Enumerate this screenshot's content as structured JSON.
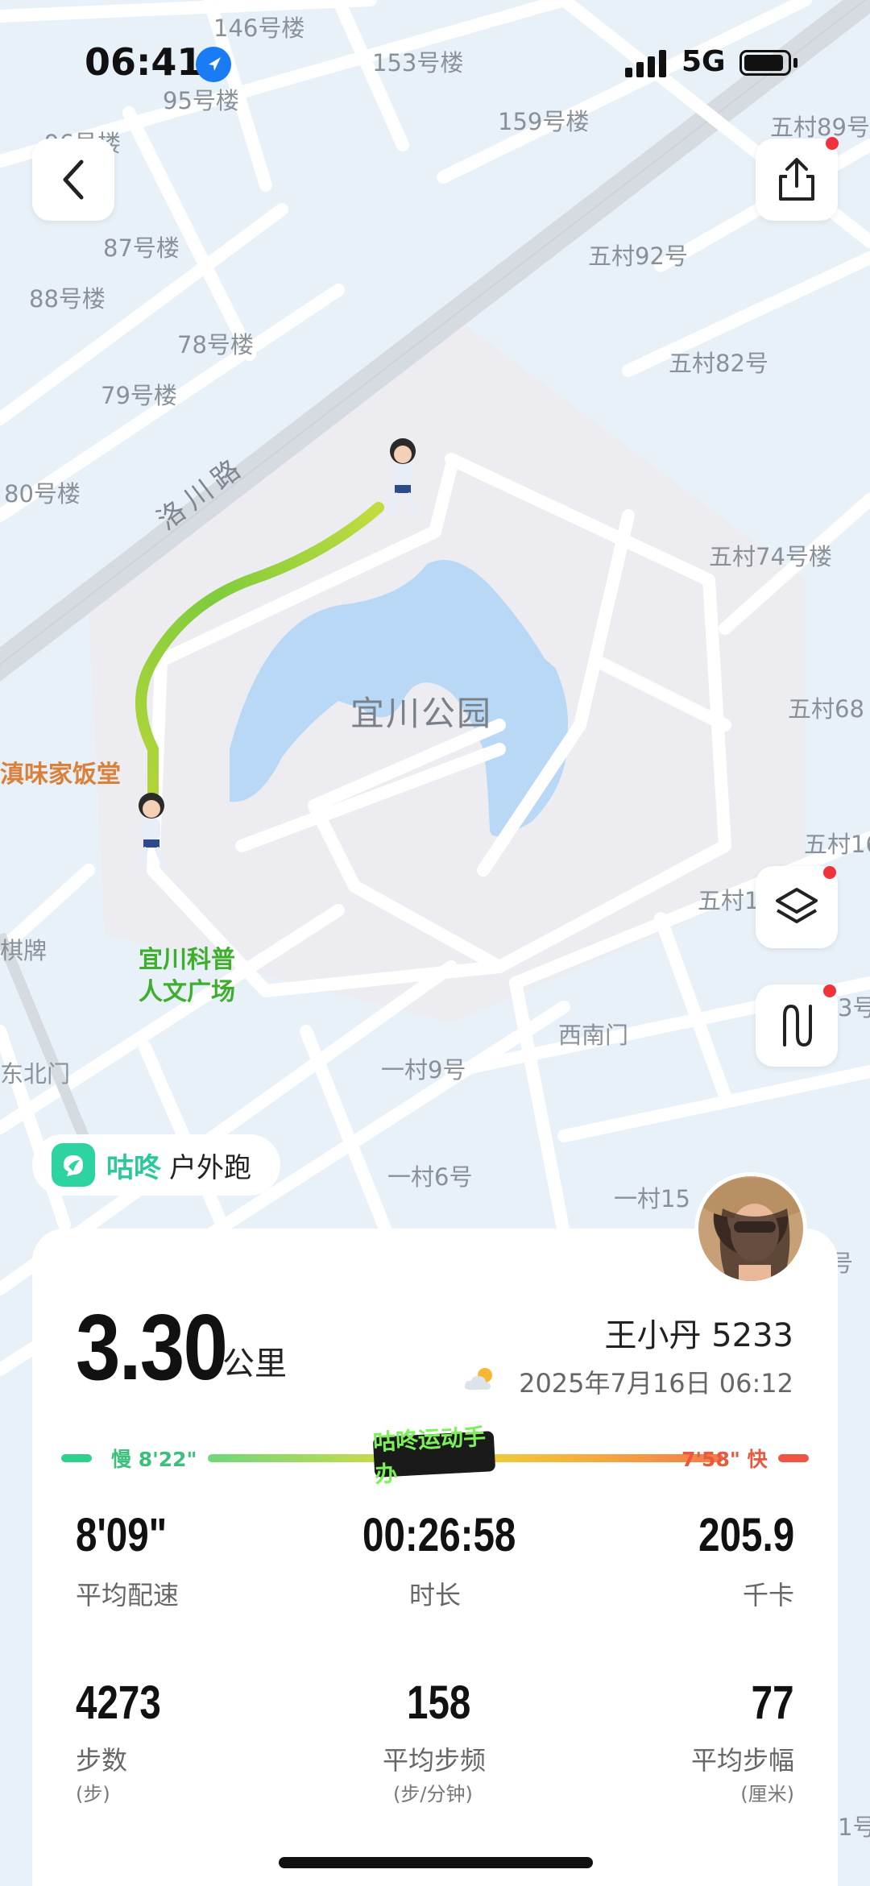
{
  "status_bar": {
    "time": "06:41",
    "network": "5G"
  },
  "map": {
    "labels": [
      "146号楼",
      "153号楼",
      "95号楼",
      "159号楼",
      "五村89号",
      "96号楼",
      "87号楼",
      "88号楼",
      "五村92号",
      "78号楼",
      "五村82号",
      "79号楼",
      "80号楼",
      "五村74号楼",
      "五村68",
      "五村16",
      "五村1",
      "一村9号",
      "一村6号",
      "一村15",
      "西南门",
      "东北门",
      "棋牌",
      "3号",
      "号",
      "1号"
    ],
    "road": "洛川路",
    "park": "宜川公园",
    "poi_orange": "滇味家饭堂",
    "poi_green_line1": "宜川科普",
    "poi_green_line2": "人文广场"
  },
  "app": {
    "name": "咕咚",
    "type": "户外跑"
  },
  "summary": {
    "distance": "3.30",
    "distance_unit": "公里",
    "user": "王小丹 5233",
    "date": "2025年7月16日 06:12"
  },
  "pace": {
    "slow": "慢 8'22\"",
    "fast": "7'58\" 快",
    "logo": "咕咚运动手办"
  },
  "stats": {
    "avg_pace": {
      "value": "8'09\"",
      "label": "平均配速"
    },
    "duration": {
      "value": "00:26:58",
      "label": "时长"
    },
    "calories": {
      "value": "205.9",
      "label": "千卡"
    },
    "steps": {
      "value": "4273",
      "label": "步数",
      "unit": "(步)"
    },
    "cadence": {
      "value": "158",
      "label": "平均步频",
      "unit": "(步/分钟)"
    },
    "stride": {
      "value": "77",
      "label": "平均步幅",
      "unit": "(厘米)"
    }
  },
  "colors": {
    "accent_green": "#2cc89a",
    "route_start": "#8cd23a",
    "slow": "#3bbf7a",
    "fast": "#e85a3f"
  }
}
